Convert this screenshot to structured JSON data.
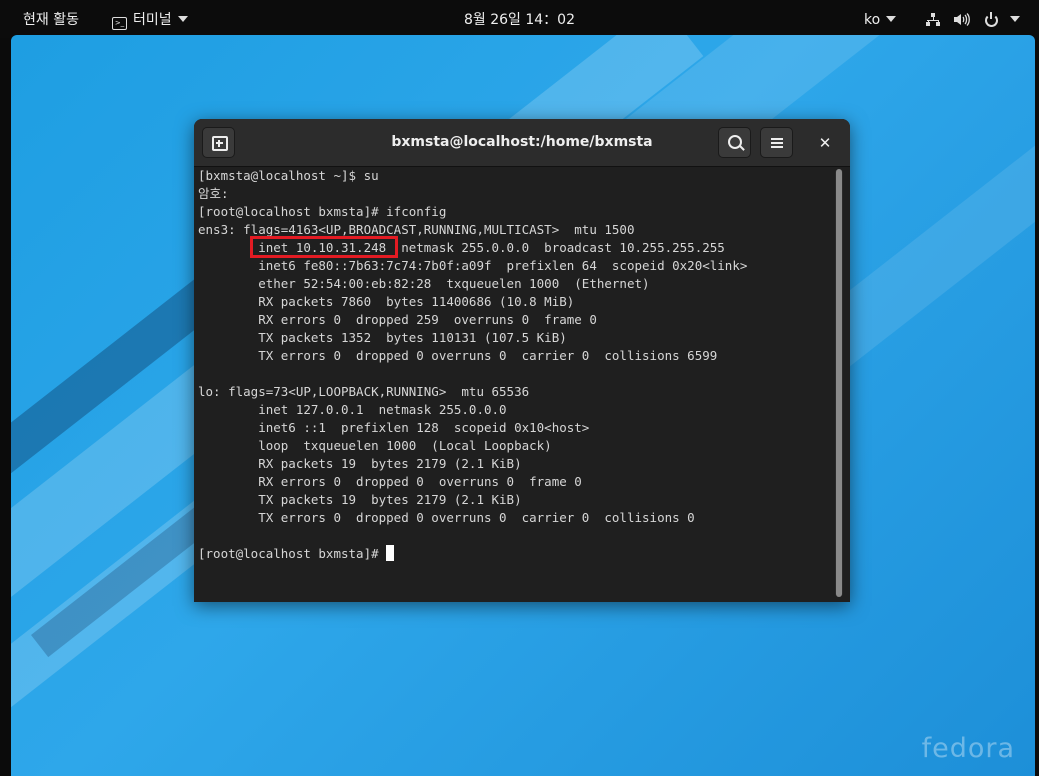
{
  "topbar": {
    "activities": "현재 활동",
    "app_menu": "터미널",
    "clock": "8월 26일 14：02",
    "language": "ko"
  },
  "terminal": {
    "title": "bxmsta@localhost:/home/bxmsta",
    "lines": [
      "[bxmsta@localhost ~]$ su",
      "암호:",
      "[root@localhost bxmsta]# ifconfig",
      "ens3: flags=4163<UP,BROADCAST,RUNNING,MULTICAST>  mtu 1500",
      "        inet 10.10.31.248  netmask 255.0.0.0  broadcast 10.255.255.255",
      "        inet6 fe80::7b63:7c74:7b0f:a09f  prefixlen 64  scopeid 0x20<link>",
      "        ether 52:54:00:eb:82:28  txqueuelen 1000  (Ethernet)",
      "        RX packets 7860  bytes 11400686 (10.8 MiB)",
      "        RX errors 0  dropped 259  overruns 0  frame 0",
      "        TX packets 1352  bytes 110131 (107.5 KiB)",
      "        TX errors 0  dropped 0 overruns 0  carrier 0  collisions 6599",
      "",
      "lo: flags=73<UP,LOOPBACK,RUNNING>  mtu 65536",
      "        inet 127.0.0.1  netmask 255.0.0.0",
      "        inet6 ::1  prefixlen 128  scopeid 0x10<host>",
      "        loop  txqueuelen 1000  (Local Loopback)",
      "        RX packets 19  bytes 2179 (2.1 KiB)",
      "        RX errors 0  dropped 0  overruns 0  frame 0",
      "        TX packets 19  bytes 2179 (2.1 KiB)",
      "        TX errors 0  dropped 0 overruns 0  carrier 0  collisions 0",
      ""
    ],
    "prompt": "[root@localhost bxmsta]# "
  },
  "desktop": {
    "watermark": "fedora"
  },
  "colors": {
    "highlight": "#e31b23",
    "desktop_blue": "#1e9ee2",
    "terminal_bg": "#1f1f1f"
  },
  "icons": [
    "terminal-icon",
    "network-icon",
    "volume-icon",
    "power-icon",
    "new-tab-icon",
    "search-icon",
    "menu-icon",
    "close-icon"
  ]
}
